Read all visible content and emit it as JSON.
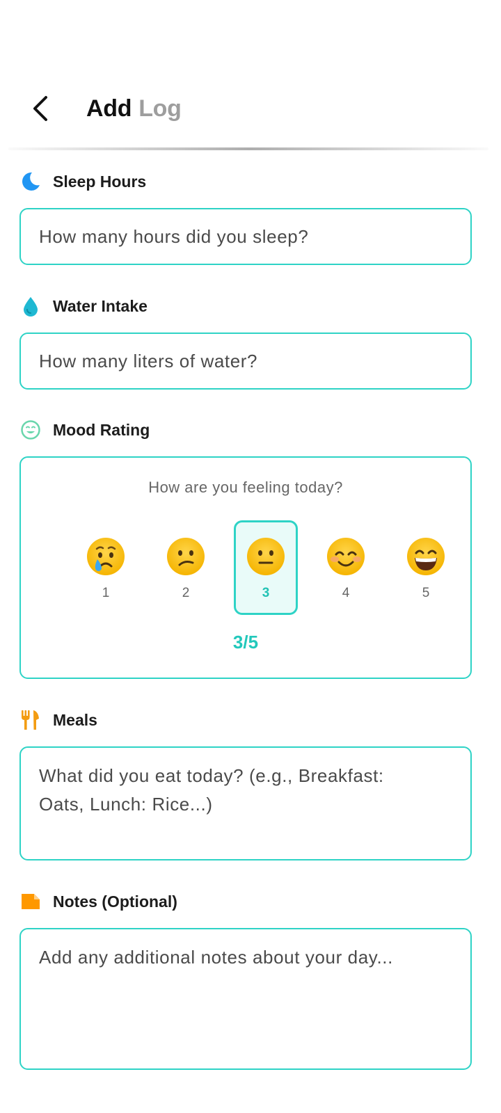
{
  "header": {
    "title_main": "Add",
    "title_sub": "Log",
    "back_icon": "chevron-left-icon"
  },
  "sleep": {
    "label": "Sleep Hours",
    "icon": "moon-icon",
    "icon_color": "#2196f3",
    "placeholder": "How many hours did you sleep?"
  },
  "water": {
    "label": "Water Intake",
    "icon": "water-drop-icon",
    "icon_color": "#1fb8d2",
    "placeholder": "How many liters of water?"
  },
  "mood": {
    "label": "Mood Rating",
    "icon": "smiley-icon",
    "icon_color": "#69d6ac",
    "question": "How are you feeling today?",
    "options": [
      {
        "value": "1",
        "icon": "crying-face-icon"
      },
      {
        "value": "2",
        "icon": "confused-face-icon"
      },
      {
        "value": "3",
        "icon": "neutral-face-icon"
      },
      {
        "value": "4",
        "icon": "smiling-face-icon"
      },
      {
        "value": "5",
        "icon": "grinning-face-icon"
      }
    ],
    "selected": 3,
    "score_text": "3/5"
  },
  "meals": {
    "label": "Meals",
    "icon": "fork-knife-icon",
    "icon_color": "#f39c12",
    "placeholder_line1": "What did you eat today? (e.g., Breakfast:",
    "placeholder_line2": "Oats, Lunch: Rice...)"
  },
  "notes": {
    "label": "Notes (Optional)",
    "icon": "note-icon",
    "icon_color": "#ff9800",
    "placeholder": "Add any additional notes about your day..."
  },
  "colors": {
    "accent": "#2ed3c6",
    "accent_text": "#22c8bb"
  }
}
